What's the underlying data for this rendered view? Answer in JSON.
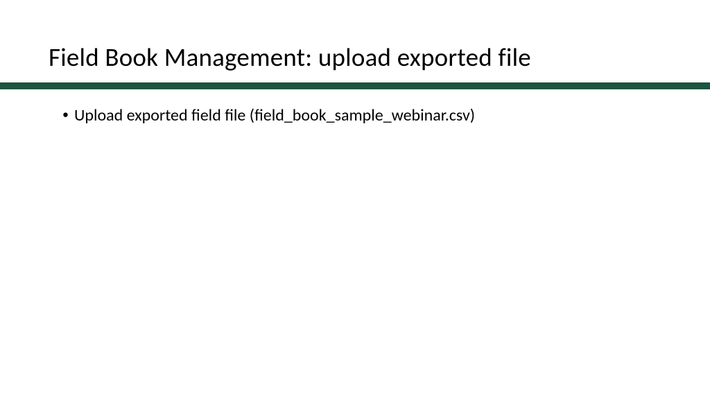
{
  "slide": {
    "title": "Field Book Management: upload exported file",
    "bullets": [
      "Upload exported field file (field_book_sample_webinar.csv)"
    ]
  },
  "colors": {
    "divider": "#1e5440"
  }
}
